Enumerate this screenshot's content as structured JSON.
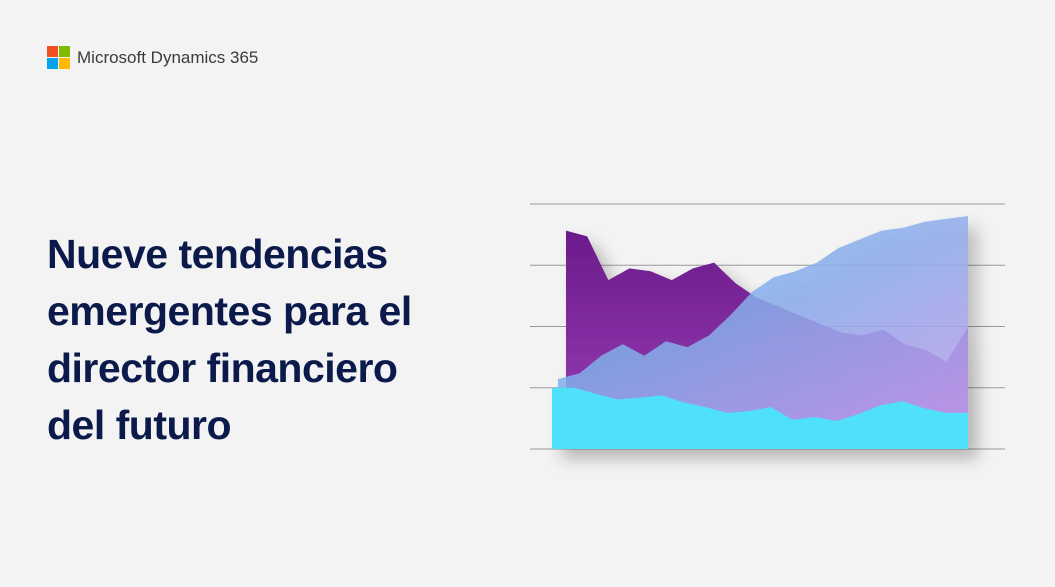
{
  "brand": {
    "name": "Microsoft Dynamics 365",
    "logo_colors": [
      "#f25022",
      "#7fba00",
      "#00a4ef",
      "#ffb900"
    ]
  },
  "headline": {
    "lines": [
      "Nueve tendencias",
      "emergentes para el",
      "director financiero",
      "del futuro"
    ]
  },
  "colors": {
    "background": "#f3f3f3",
    "headline": "#0b1a4a",
    "gridline": "#9a9a9a"
  },
  "chart_data": {
    "type": "area",
    "title": "",
    "xlabel": "",
    "ylabel": "",
    "ylim": [
      0,
      4
    ],
    "gridlines": 5,
    "legend": "none",
    "x": [
      0,
      1,
      2,
      3,
      4,
      5,
      6,
      7,
      8,
      9,
      10,
      11,
      12,
      13,
      14,
      15,
      16,
      17,
      18,
      19
    ],
    "series": [
      {
        "values": [
          3.75,
          3.65,
          2.9,
          3.1,
          3.05,
          2.9,
          3.1,
          3.2,
          2.85,
          2.6,
          2.45,
          2.3,
          2.15,
          2.0,
          1.95,
          2.05,
          1.8,
          1.7,
          1.5,
          2.1
        ],
        "color_top": "#6a1b8a",
        "color_bottom": "#9b3fb8"
      },
      {
        "values": [
          1.2,
          1.3,
          1.6,
          1.8,
          1.6,
          1.85,
          1.75,
          1.95,
          2.3,
          2.7,
          2.95,
          3.05,
          3.2,
          3.45,
          3.6,
          3.75,
          3.8,
          3.9,
          3.95,
          4.0
        ],
        "color_top": "#58b7e8",
        "color_bottom": "#c9a2f0"
      },
      {
        "values": [
          1.05,
          1.05,
          0.95,
          0.85,
          0.88,
          0.92,
          0.8,
          0.72,
          0.62,
          0.65,
          0.72,
          0.5,
          0.55,
          0.48,
          0.6,
          0.75,
          0.82,
          0.7,
          0.62,
          0.62
        ],
        "color_top": "#4fe0fb",
        "color_bottom": "#4fe0fb"
      }
    ]
  }
}
